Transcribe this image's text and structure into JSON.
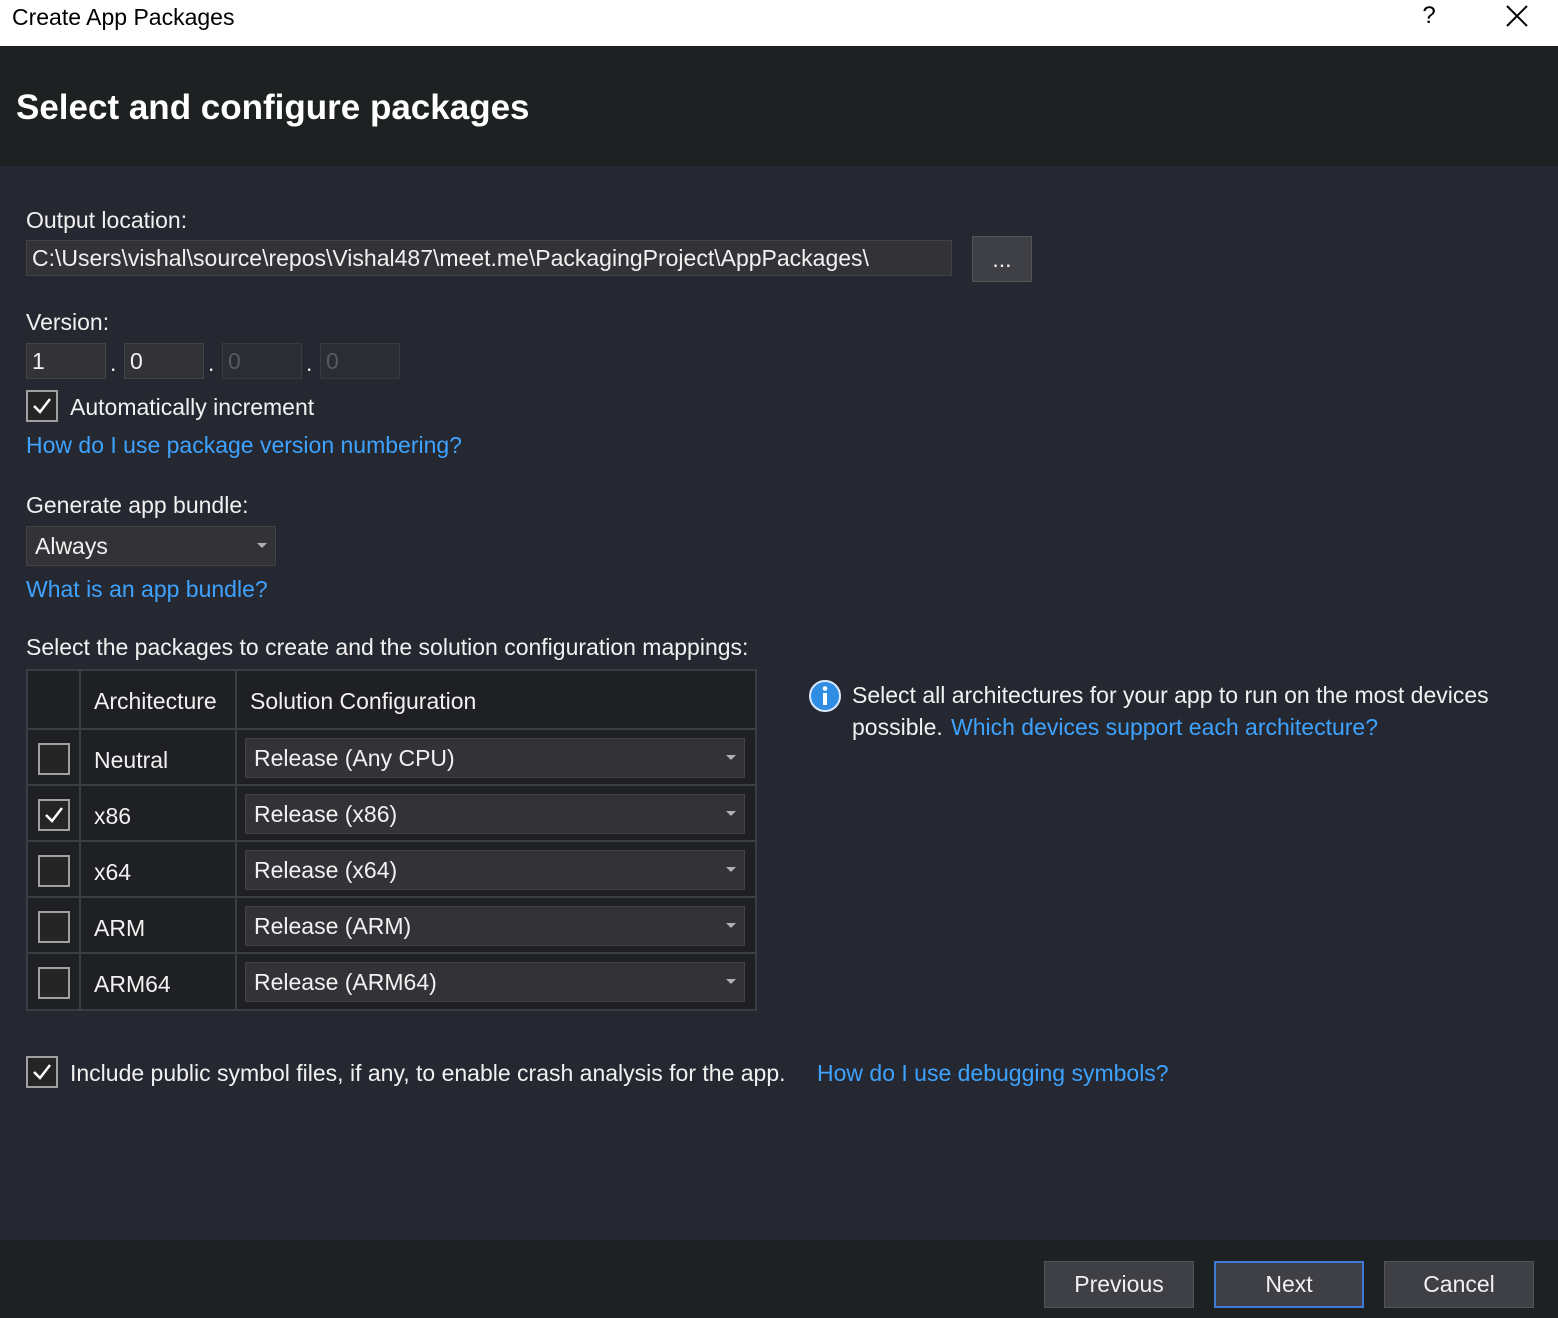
{
  "window": {
    "title": "Create App Packages",
    "help_label": "?",
    "close_icon": "close-icon"
  },
  "header": {
    "title": "Select and configure packages"
  },
  "output": {
    "label": "Output location:",
    "path": "C:\\Users\\vishal\\source\\repos\\Vishal487\\meet.me\\PackagingProject\\AppPackages\\",
    "browse_label": "..."
  },
  "version": {
    "label": "Version:",
    "parts": [
      "1",
      "0",
      "0",
      "0"
    ],
    "separator": ".",
    "auto_increment_label": "Automatically increment",
    "auto_increment_checked": true,
    "help_link": "How do I use package version numbering?"
  },
  "bundle": {
    "label": "Generate app bundle:",
    "selected": "Always",
    "help_link": "What is an app bundle?"
  },
  "packages": {
    "label": "Select the packages to create and the solution configuration mappings:",
    "headers": {
      "architecture": "Architecture",
      "configuration": "Solution Configuration"
    },
    "rows": [
      {
        "architecture": "Neutral",
        "configuration": "Release (Any CPU)",
        "checked": false
      },
      {
        "architecture": "x86",
        "configuration": "Release (x86)",
        "checked": true
      },
      {
        "architecture": "x64",
        "configuration": "Release (x64)",
        "checked": false
      },
      {
        "architecture": "ARM",
        "configuration": "Release (ARM)",
        "checked": false
      },
      {
        "architecture": "ARM64",
        "configuration": "Release (ARM64)",
        "checked": false
      }
    ],
    "info_text_1": "Select all architectures for your app to run on the most devices",
    "info_text_2": "possible.",
    "info_link": "Which devices support each architecture?"
  },
  "symbols": {
    "checked": true,
    "label": "Include public symbol files, if any, to enable crash analysis for the app.",
    "help_link": "How do I use debugging symbols?"
  },
  "footer": {
    "previous_label": "Previous",
    "next_label": "Next",
    "cancel_label": "Cancel"
  },
  "colors": {
    "accent_link": "#3ea2ff",
    "background": "#252830",
    "header_bg": "#1e2122",
    "info_icon": "#2f8de4"
  }
}
